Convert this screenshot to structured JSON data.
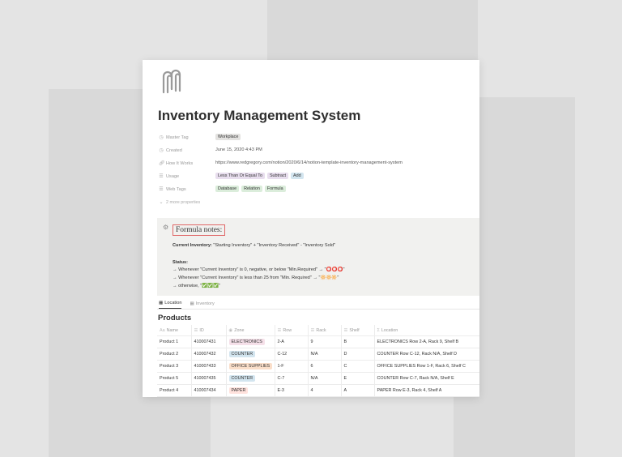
{
  "page": {
    "title": "Inventory Management System",
    "icon": "paperclip-icon"
  },
  "properties": [
    {
      "name": "Master Tag",
      "icon": "clock-icon",
      "tags": [
        {
          "text": "Workplace",
          "color": "gray"
        }
      ]
    },
    {
      "name": "Created",
      "icon": "clock-icon",
      "value": "June 15, 2020 4:43 PM"
    },
    {
      "name": "How It Works",
      "icon": "link-icon",
      "value": "https://www.redgregory.com/notion/2020/6/14/notion-template-inventory-management-system"
    },
    {
      "name": "Usage",
      "icon": "list-icon",
      "tags": [
        {
          "text": "Less Than Or Equal To",
          "color": "purple"
        },
        {
          "text": "Subtract",
          "color": "purple"
        },
        {
          "text": "Add",
          "color": "blue"
        }
      ]
    },
    {
      "name": "Web Tags",
      "icon": "list-icon",
      "tags": [
        {
          "text": "Database",
          "color": "green"
        },
        {
          "text": "Relation",
          "color": "green"
        },
        {
          "text": "Formula",
          "color": "green"
        }
      ]
    }
  ],
  "more_properties": "2 more properties",
  "callout": {
    "icon": "gear-icon",
    "title": "Formula notes:",
    "current_label": "Current Inventory:",
    "current_text": " \"Starting Inventory\" + \"Inventory Received\" - \"Inventory Sold\"",
    "status_label": "Status:",
    "line1": "→ Whenever \"Current Inventory\" is 0, negative, or below \"Min.Required\" → \"",
    "line1_emoji": "⭕⭕⭕",
    "line2": "→ Whenever \"Current Inventory\" is less than 25 from \"Min. Required\" → \"",
    "line2_emoji": "🔆🔆🔆",
    "line3": "→ otherwise, \"",
    "line3_emoji": "✅✅✅",
    "quote_end": "\""
  },
  "tabs": [
    {
      "label": "Location",
      "active": true
    },
    {
      "label": "Inventory",
      "active": false
    }
  ],
  "database": {
    "title": "Products",
    "columns": [
      "Name",
      "ID",
      "Zone",
      "Row",
      "Rack",
      "Shelf",
      "Location"
    ],
    "rows": [
      {
        "name": "Product 1",
        "id": "410007431",
        "zone": "ELECTRONICS",
        "zone_color": "pink",
        "row": "2-A",
        "rack": "9",
        "shelf": "B",
        "location": "ELECTRONICS Row 2-A, Rack 9, Shelf B"
      },
      {
        "name": "Product 2",
        "id": "410007432",
        "zone": "COUNTER",
        "zone_color": "blue",
        "row": "C-12",
        "rack": "N/A",
        "shelf": "D",
        "location": "COUNTER Row C-12, Rack N/A, Shelf D"
      },
      {
        "name": "Product 3",
        "id": "410007433",
        "zone": "OFFICE SUPPLIES",
        "zone_color": "orange",
        "row": "1-F",
        "rack": "6",
        "shelf": "C",
        "location": "OFFICE SUPPLIES Row 1-F, Rack 6, Shelf C"
      },
      {
        "name": "Product 5",
        "id": "410007435",
        "zone": "COUNTER",
        "zone_color": "blue",
        "row": "C-7",
        "rack": "N/A",
        "shelf": "E",
        "location": "COUNTER Row C-7, Rack N/A, Shelf E"
      },
      {
        "name": "Product 4",
        "id": "410007434",
        "zone": "PAPER",
        "zone_color": "red",
        "row": "E-3",
        "rack": "4",
        "shelf": "A",
        "location": "PAPER Row E-3, Rack 4, Shelf A"
      }
    ]
  },
  "colors": {
    "background": "#e4e4e4",
    "callout_bg": "#f1f1ef",
    "notes_border": "#e06666"
  }
}
